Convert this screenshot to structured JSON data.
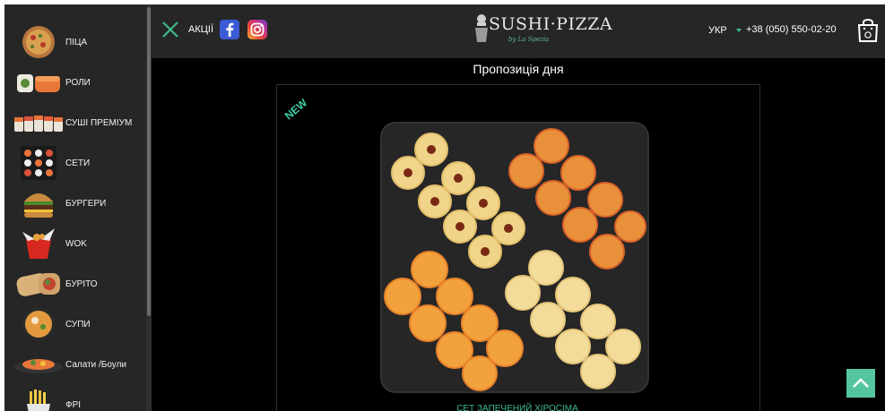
{
  "sidebar": {
    "items": [
      {
        "label": "Піца"
      },
      {
        "label": "Роли"
      },
      {
        "label": "Суші преміум"
      },
      {
        "label": "Сети"
      },
      {
        "label": "Бургери"
      },
      {
        "label": "Wok"
      },
      {
        "label": "Буріто"
      },
      {
        "label": "Супи"
      },
      {
        "label": "Салати /Боули"
      },
      {
        "label": "Фрі"
      }
    ]
  },
  "header": {
    "promo_label": "Акції",
    "logo_text": "SUSHI·PIZZA",
    "logo_sub": "by La Spezia",
    "language": "УКР",
    "phone": "+38 (050) 550-02-20"
  },
  "main": {
    "offer_title": "Пропозиція дня",
    "badge": "NEW",
    "product_name": "Сет запечений Хіросіма"
  },
  "colors": {
    "accent": "#3fb98a",
    "background": "#000000",
    "panel": "#262626",
    "scroll_top_button": "#55c4a1"
  },
  "icons": {
    "close": "close-icon",
    "facebook": "facebook-icon",
    "instagram": "instagram-icon",
    "bag": "shopping-bag-icon",
    "up": "arrow-up-icon"
  }
}
